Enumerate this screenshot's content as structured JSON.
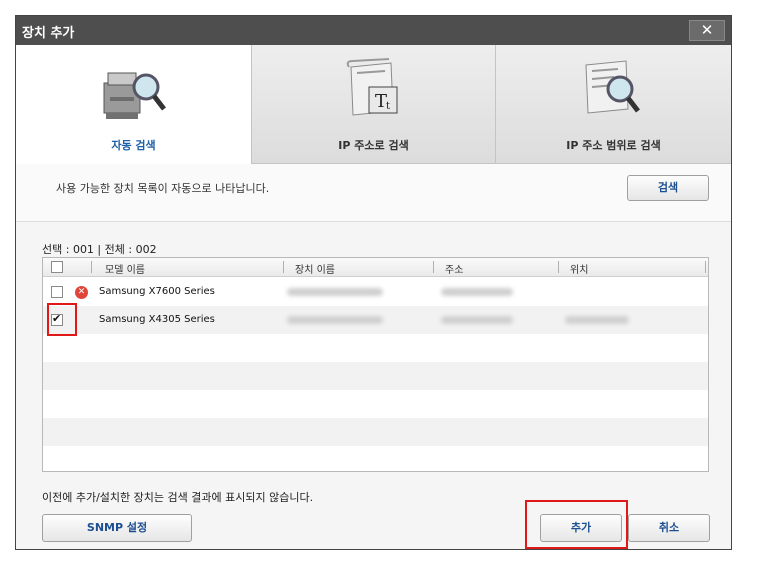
{
  "window": {
    "title": "장치 추가",
    "close_glyph": "✕"
  },
  "tabs": [
    {
      "label": "자동 검색",
      "active": true,
      "icon": "printer-magnifier-icon"
    },
    {
      "label": "IP 주소로 검색",
      "active": false,
      "icon": "scroll-text-icon"
    },
    {
      "label": "IP 주소 범위로 검색",
      "active": false,
      "icon": "scroll-magnifier-icon"
    }
  ],
  "description": "사용 가능한 장치 목록이 자동으로 나타납니다.",
  "search_button": "검색",
  "counts": "선택 : 001 | 전체 : 002",
  "table": {
    "columns": [
      "모델 이름",
      "장치 이름",
      "주소",
      "위치"
    ],
    "rows": [
      {
        "model": "Samsung X7600 Series",
        "checked": false,
        "status": "error"
      },
      {
        "model": "Samsung X4305 Series",
        "checked": true,
        "status": "ok"
      }
    ]
  },
  "note": "이전에 추가/설치한 장치는 검색 결과에 표시되지 않습니다.",
  "buttons": {
    "snmp": "SNMP 설정",
    "add": "추가",
    "cancel": "취소"
  },
  "colors": {
    "accent": "#1d5fa8",
    "highlight": "#e01818",
    "titlebar": "#4e4e4e"
  }
}
